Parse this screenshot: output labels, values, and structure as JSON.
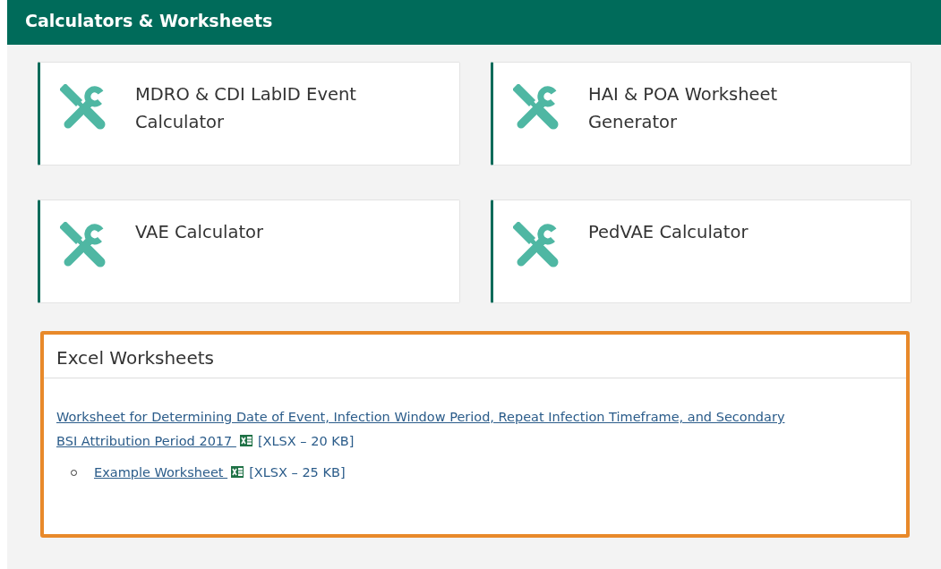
{
  "header": {
    "title": "Calculators & Worksheets"
  },
  "tools": [
    {
      "label": "MDRO & CDI LabID Event Calculator"
    },
    {
      "label": "HAI & POA Worksheet Generator"
    },
    {
      "label": "VAE Calculator"
    },
    {
      "label": "PedVAE Calculator"
    }
  ],
  "excel_panel": {
    "title": "Excel Worksheets",
    "highlighted": true,
    "files": [
      {
        "link": "Worksheet for Determining Date of Event, Infection Window Period, Repeat Infection Timeframe, and Secondary BSI Attribution Period 2017",
        "size": "[XLSX – 20 KB]",
        "children": [
          {
            "link": "Example Worksheet",
            "size": "[XLSX – 25 KB]"
          }
        ]
      }
    ]
  }
}
